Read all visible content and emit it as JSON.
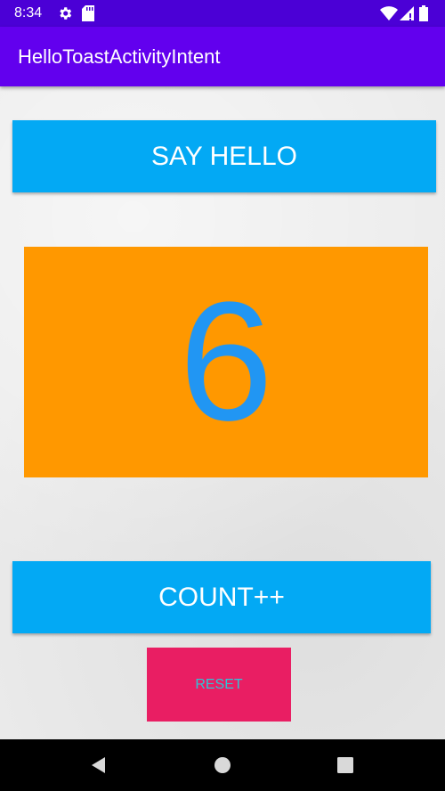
{
  "status_bar": {
    "time": "8:34",
    "icons": [
      "gear-icon",
      "sd-card-icon",
      "wifi-icon",
      "signal-icon",
      "battery-icon"
    ]
  },
  "app_bar": {
    "title": "HelloToastActivityIntent"
  },
  "main": {
    "say_hello_label": "SAY HELLO",
    "count": "6",
    "count_label": "COUNT++",
    "reset_label": "RESET"
  },
  "nav_bar": {
    "icons": [
      "back-icon",
      "home-icon",
      "recents-icon"
    ]
  },
  "colors": {
    "status_bar": "#4b00d6",
    "app_bar": "#6200ee",
    "button_blue": "#03a9f4",
    "count_box": "#ff9800",
    "count_text": "#2196f3",
    "reset_button": "#e91e63",
    "reset_text": "#2ec4d6"
  }
}
